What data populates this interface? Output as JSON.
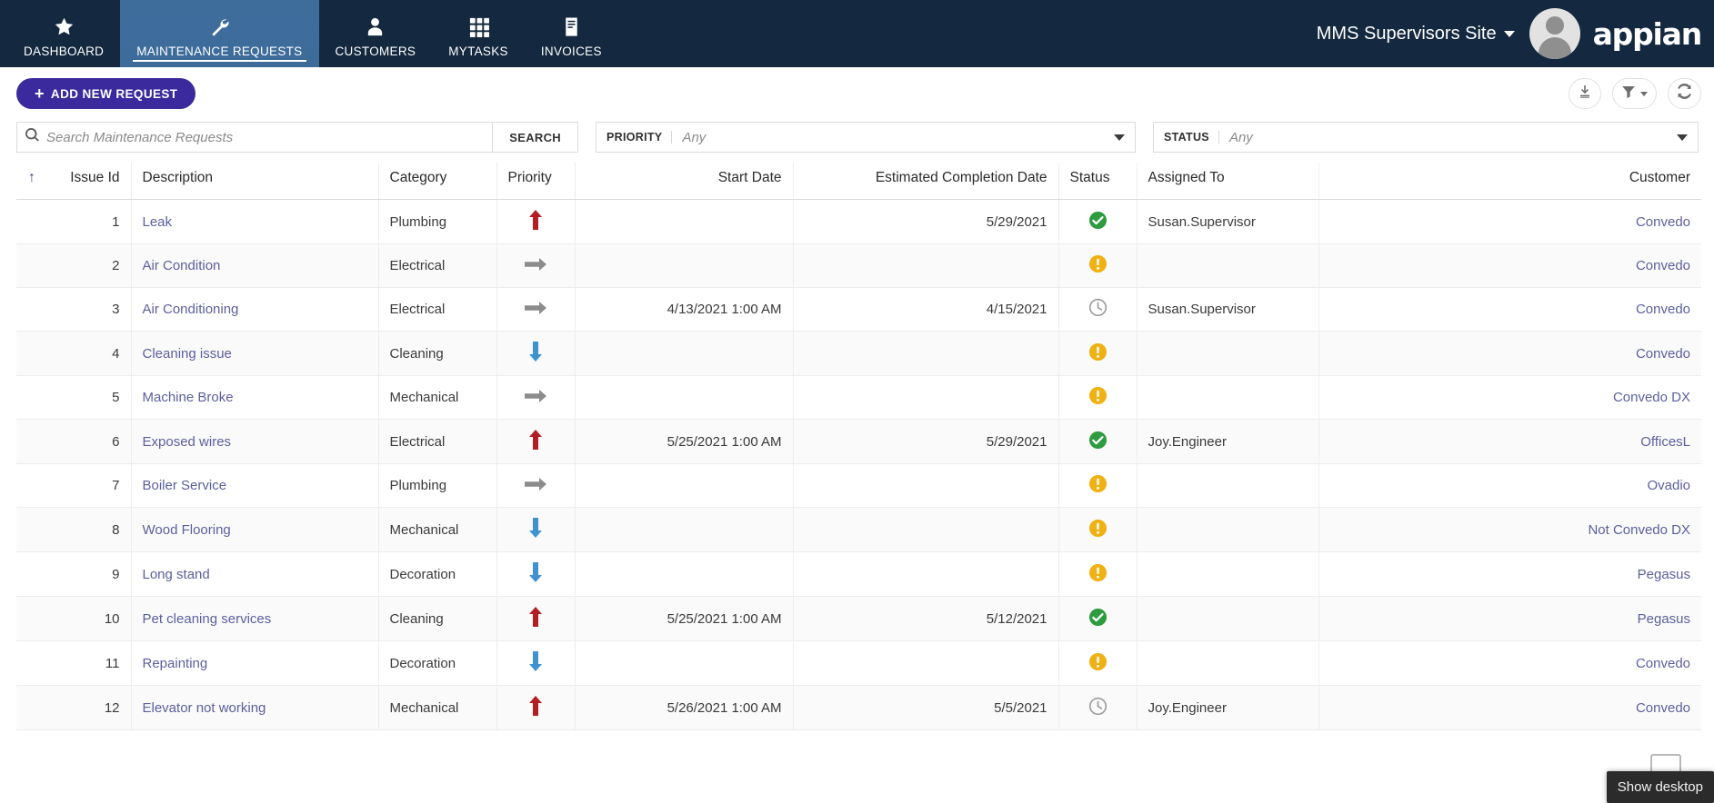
{
  "topnav": {
    "items": [
      {
        "label": "DASHBOARD",
        "icon": "star-icon",
        "active": false
      },
      {
        "label": "MAINTENANCE REQUESTS",
        "icon": "wrench-icon",
        "active": true
      },
      {
        "label": "CUSTOMERS",
        "icon": "person-icon",
        "active": false
      },
      {
        "label": "MYTASKS",
        "icon": "grid-apps-icon",
        "active": false
      },
      {
        "label": "INVOICES",
        "icon": "document-icon",
        "active": false
      }
    ],
    "site_name": "MMS Supervisors Site",
    "brand": "appian",
    "bar_color": "#14283f",
    "active_tab_color": "#3e6d9c"
  },
  "toolbar": {
    "add_new_label": "ADD NEW REQUEST",
    "add_new_plus": "+",
    "add_new_color": "#3a2a9e",
    "export_icon": "download-icon",
    "filter_icon": "funnel-icon",
    "refresh_icon": "refresh-icon"
  },
  "search": {
    "placeholder": "Search Maintenance Requests",
    "value": "",
    "button_label": "SEARCH",
    "icon": "search-icon"
  },
  "filters": [
    {
      "label": "PRIORITY",
      "value": "Any",
      "icon": "chevron-down-icon"
    },
    {
      "label": "STATUS",
      "value": "Any",
      "icon": "chevron-down-icon"
    }
  ],
  "table": {
    "sort_indicator": "↑",
    "columns": [
      "Issue Id",
      "Description",
      "Category",
      "Priority",
      "Start Date",
      "Estimated Completion Date",
      "Status",
      "Assigned To",
      "Customer"
    ],
    "rows": [
      {
        "id": "1",
        "description": "Leak",
        "category": "Plumbing",
        "priority": "high",
        "start_date": "",
        "ecd": "5/29/2021",
        "status": "complete",
        "assigned_to": "Susan.Supervisor",
        "customer": "Convedo"
      },
      {
        "id": "2",
        "description": "Air Condition",
        "category": "Electrical",
        "priority": "medium",
        "start_date": "",
        "ecd": "",
        "status": "attention",
        "assigned_to": "",
        "customer": "Convedo"
      },
      {
        "id": "3",
        "description": "Air Conditioning",
        "category": "Electrical",
        "priority": "medium",
        "start_date": "4/13/2021 1:00 AM",
        "ecd": "4/15/2021",
        "status": "pending",
        "assigned_to": "Susan.Supervisor",
        "customer": "Convedo"
      },
      {
        "id": "4",
        "description": "Cleaning issue",
        "category": "Cleaning",
        "priority": "low",
        "start_date": "",
        "ecd": "",
        "status": "attention",
        "assigned_to": "",
        "customer": "Convedo"
      },
      {
        "id": "5",
        "description": "Machine Broke",
        "category": "Mechanical",
        "priority": "medium",
        "start_date": "",
        "ecd": "",
        "status": "attention",
        "assigned_to": "",
        "customer": "Convedo DX"
      },
      {
        "id": "6",
        "description": "Exposed wires",
        "category": "Electrical",
        "priority": "high",
        "start_date": "5/25/2021 1:00 AM",
        "ecd": "5/29/2021",
        "status": "complete",
        "assigned_to": "Joy.Engineer",
        "customer": "OfficesL"
      },
      {
        "id": "7",
        "description": "Boiler Service",
        "category": "Plumbing",
        "priority": "medium",
        "start_date": "",
        "ecd": "",
        "status": "attention",
        "assigned_to": "",
        "customer": "Ovadio"
      },
      {
        "id": "8",
        "description": "Wood Flooring",
        "category": "Mechanical",
        "priority": "low",
        "start_date": "",
        "ecd": "",
        "status": "attention",
        "assigned_to": "",
        "customer": "Not Convedo DX"
      },
      {
        "id": "9",
        "description": "Long stand",
        "category": "Decoration",
        "priority": "low",
        "start_date": "",
        "ecd": "",
        "status": "attention",
        "assigned_to": "",
        "customer": "Pegasus"
      },
      {
        "id": "10",
        "description": "Pet cleaning services",
        "category": "Cleaning",
        "priority": "high",
        "start_date": "5/25/2021 1:00 AM",
        "ecd": "5/12/2021",
        "status": "complete",
        "assigned_to": "",
        "customer": "Pegasus"
      },
      {
        "id": "11",
        "description": "Repainting",
        "category": "Decoration",
        "priority": "low",
        "start_date": "",
        "ecd": "",
        "status": "attention",
        "assigned_to": "",
        "customer": "Convedo"
      },
      {
        "id": "12",
        "description": "Elevator not working",
        "category": "Mechanical",
        "priority": "high",
        "start_date": "5/26/2021 1:00 AM",
        "ecd": "5/5/2021",
        "status": "pending",
        "assigned_to": "Joy.Engineer",
        "customer": "Convedo"
      }
    ]
  },
  "legend": {
    "priority_icons": {
      "high": {
        "name": "arrow-up-icon",
        "color": "#b11f24"
      },
      "medium": {
        "name": "arrow-right-icon",
        "color": "#8c8c8c"
      },
      "low": {
        "name": "arrow-down-icon",
        "color": "#3f92d2"
      }
    },
    "status_icons": {
      "complete": {
        "name": "check-circle-icon",
        "color": "#2e9b3f"
      },
      "attention": {
        "name": "exclamation-circle-icon",
        "color": "#efb113"
      },
      "pending": {
        "name": "clock-icon",
        "color": "#9b9b9b"
      }
    },
    "link_color": "#5c5f9e"
  },
  "desktop": {
    "show_desktop_tooltip": "Show desktop"
  }
}
